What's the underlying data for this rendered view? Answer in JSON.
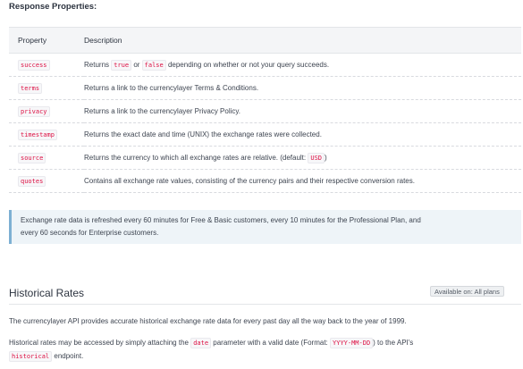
{
  "response_properties": {
    "heading": "Response Properties:",
    "columns": {
      "property": "Property",
      "description": "Description"
    },
    "rows": [
      {
        "property": "success",
        "description": {
          "pre": "Returns ",
          "code1": "true",
          "mid": " or ",
          "code2": "false",
          "post": " depending on whether or not your query succeeds."
        }
      },
      {
        "property": "terms",
        "description": "Returns a link to the currencylayer Terms & Conditions."
      },
      {
        "property": "privacy",
        "description": "Returns a link to the currencylayer Privacy Policy."
      },
      {
        "property": "timestamp",
        "description": "Returns the exact date and time (UNIX) the exchange rates were collected."
      },
      {
        "property": "source",
        "description": {
          "pre": "Returns the currency to which all exchange rates are relative. (default: ",
          "code": "USD",
          "post": ")"
        }
      },
      {
        "property": "quotes",
        "description": "Contains all exchange rate values, consisting of the currency pairs and their respective conversion rates."
      }
    ]
  },
  "note": {
    "line1": "Exchange rate data is refreshed every 60 minutes for Free & Basic customers, every 10 minutes for the Professional Plan, and",
    "line2": "every 60 seconds for Enterprise customers."
  },
  "historical": {
    "title": "Historical Rates",
    "badge": "Available on: All plans",
    "para1": "The currencylayer API provides accurate historical exchange rate data for every past day all the way back to the year of 1999.",
    "para2": {
      "pre": "Historical rates may be accessed by simply attaching the ",
      "code1": "date",
      "mid": " parameter with a valid date (Format: ",
      "code2": "YYYY-MM-DD",
      "post": ") to the API's",
      "code3": "historical",
      "end": " endpoint."
    }
  }
}
